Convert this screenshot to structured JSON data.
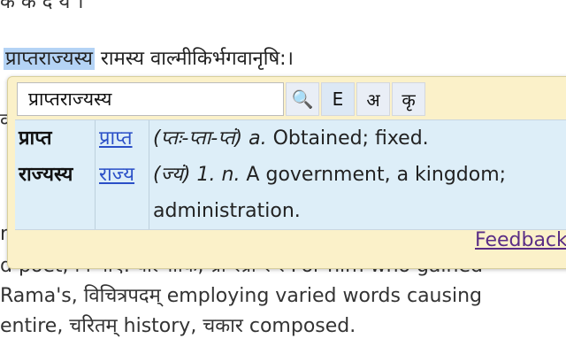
{
  "page": {
    "top_line_cut": "क  क  द   य  ।",
    "verse": {
      "selected": "प्राप्तराज्यस्य",
      "rest": " रामस्य वाल्मीकिर्भगवानृषि:।"
    },
    "left_chars": [
      "क",
      "r"
    ],
    "para_lines": [
      "d poet, गि गाए. वाल्मीकि, ग्रा रग्रा  र र For him who gained",
      " Rama's, विचित्रपदम् employing varied words causing",
      "entire, चरितम् history, चकार composed."
    ]
  },
  "popup": {
    "search_value": "प्राप्तराज्यस्य",
    "buttons": [
      {
        "label": "🔍",
        "name": "search-icon"
      },
      {
        "label": "E",
        "name": "english-button"
      },
      {
        "label": "अ",
        "name": "devanagari-button"
      },
      {
        "label": "कृ",
        "name": "krt-button"
      }
    ],
    "results": [
      {
        "word": "प्राप्त",
        "root": "प्राप्त",
        "forms": "(प्तः-प्ता-प्तं)",
        "gram": "a.",
        "def": " Obtained; fixed."
      },
      {
        "word": "राज्यस्य",
        "root": "राज्य",
        "forms": "(ज्यं)",
        "gram": "1. n.",
        "def": " A government, a kingdom; administration."
      }
    ],
    "feedback_label": "Feedback"
  }
}
